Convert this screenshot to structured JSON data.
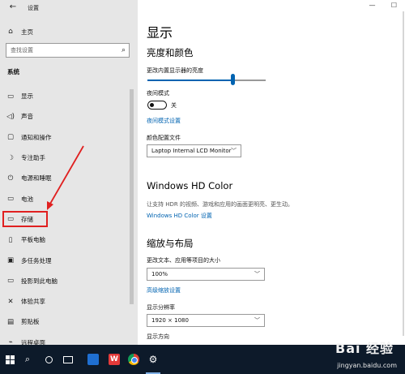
{
  "window": {
    "title": "设置",
    "controls": {
      "minimize": "—",
      "maximize": "☐"
    }
  },
  "sidebar": {
    "home_label": "主页",
    "search_placeholder": "查找设置",
    "section_label": "系统",
    "items": [
      {
        "label": "显示",
        "icon": "monitor-icon",
        "glyph": "▭"
      },
      {
        "label": "声音",
        "icon": "sound-icon",
        "glyph": "◁)"
      },
      {
        "label": "通知和操作",
        "icon": "notification-icon",
        "glyph": "▢"
      },
      {
        "label": "专注助手",
        "icon": "moon-icon",
        "glyph": "☽"
      },
      {
        "label": "电源和睡眠",
        "icon": "power-icon",
        "glyph": "⏻"
      },
      {
        "label": "电池",
        "icon": "battery-icon",
        "glyph": "▭"
      },
      {
        "label": "存储",
        "icon": "storage-icon",
        "glyph": "▭"
      },
      {
        "label": "平板电脑",
        "icon": "tablet-icon",
        "glyph": "▯"
      },
      {
        "label": "多任务处理",
        "icon": "multitask-icon",
        "glyph": "▣"
      },
      {
        "label": "投影到此电脑",
        "icon": "project-icon",
        "glyph": "▭"
      },
      {
        "label": "体验共享",
        "icon": "share-icon",
        "glyph": "✕"
      },
      {
        "label": "剪贴板",
        "icon": "clipboard-icon",
        "glyph": "▤"
      },
      {
        "label": "远程桌面",
        "icon": "remote-desktop-icon",
        "glyph": "⌁"
      }
    ]
  },
  "main": {
    "page_title": "显示",
    "brightness_section": "亮度和颜色",
    "brightness_label": "更改内置显示器的亮度",
    "brightness_value": 0.72,
    "night_light_label": "夜间模式",
    "night_light_state": "关",
    "night_light_link": "夜间模式设置",
    "color_profile_label": "颜色配置文件",
    "color_profile_value": "Laptop Internal LCD Monitor",
    "hd_color_section": "Windows HD Color",
    "hd_color_desc": "让支持 HDR 的视频、游戏和应用的画面更明亮、更生动。",
    "hd_color_link": "Windows HD Color 设置",
    "scale_section": "缩放与布局",
    "scale_label": "更改文本、应用等项目的大小",
    "scale_value": "100%",
    "advanced_scale_link": "高级缩放设置",
    "resolution_label": "显示分辨率",
    "resolution_value": "1920 × 1080",
    "orientation_label": "显示方向"
  },
  "taskbar": {
    "wps_glyph": "W",
    "settings_glyph": "⚙"
  },
  "watermark": {
    "brand": "Bai 经验",
    "url": "jingyan.baidu.com"
  },
  "colors": {
    "accent": "#0063b1",
    "annotation": "#e02020",
    "sidebar_bg": "#e6e6e6",
    "taskbar_bg": "#0d1a2a"
  }
}
